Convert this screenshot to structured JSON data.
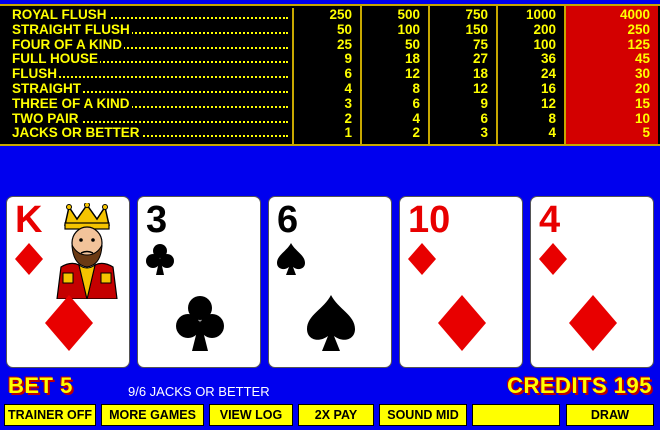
{
  "paytable": {
    "hands": [
      "ROYAL FLUSH",
      "STRAIGHT FLUSH",
      "FOUR OF A KIND",
      "FULL HOUSE",
      "FLUSH",
      "STRAIGHT",
      "THREE OF A KIND",
      "TWO PAIR",
      "JACKS OR BETTER"
    ],
    "columns": [
      [
        "250",
        "50",
        "25",
        "9",
        "6",
        "4",
        "3",
        "2",
        "1"
      ],
      [
        "500",
        "100",
        "50",
        "18",
        "12",
        "8",
        "6",
        "4",
        "2"
      ],
      [
        "750",
        "150",
        "75",
        "27",
        "18",
        "12",
        "9",
        "6",
        "3"
      ],
      [
        "1000",
        "200",
        "100",
        "36",
        "24",
        "16",
        "12",
        "8",
        "4"
      ],
      [
        "4000",
        "250",
        "125",
        "45",
        "30",
        "20",
        "15",
        "10",
        "5"
      ]
    ],
    "highlight_column": 4,
    "highlight_color": "#d30000",
    "text_color": "#ffff00"
  },
  "cards": [
    {
      "rank": "K",
      "suit": "diamonds",
      "color": "red"
    },
    {
      "rank": "3",
      "suit": "clubs",
      "color": "black"
    },
    {
      "rank": "6",
      "suit": "spades",
      "color": "black"
    },
    {
      "rank": "10",
      "suit": "diamonds",
      "color": "red"
    },
    {
      "rank": "4",
      "suit": "diamonds",
      "color": "red"
    }
  ],
  "status": {
    "bet": "BET 5",
    "game_name": "9/6 JACKS OR BETTER",
    "credits": "CREDITS 195"
  },
  "buttons": [
    "TRAINER OFF",
    "MORE GAMES",
    "VIEW LOG",
    "2X PAY",
    "SOUND MID",
    "",
    "DRAW"
  ],
  "colors": {
    "background": "#0000ee",
    "button": "#ffff00",
    "accent_red": "#c00000"
  }
}
